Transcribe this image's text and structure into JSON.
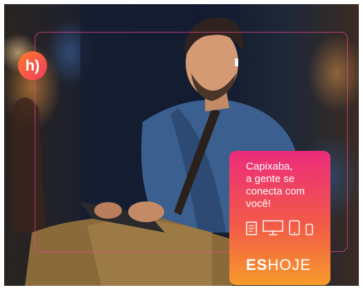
{
  "logo": {
    "text": "h)"
  },
  "card": {
    "lines": [
      "Capixaba,",
      "a gente se",
      "conecta com",
      "você!"
    ],
    "devices": [
      "document-icon",
      "monitor-icon",
      "tablet-icon",
      "phone-icon"
    ]
  },
  "brand": {
    "es": "ES",
    "hoje": "HOJE"
  },
  "colors": {
    "pink": "#ec2c7b",
    "orange": "#f79a2a"
  }
}
